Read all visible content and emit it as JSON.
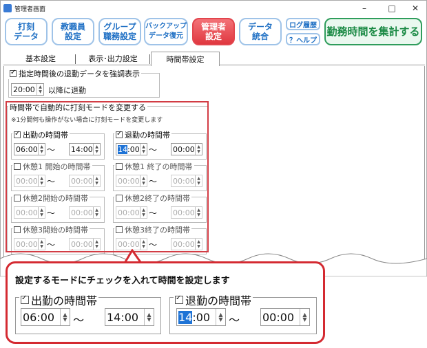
{
  "window": {
    "title": "管理者画面",
    "min": "–",
    "max": "□",
    "close": "✕"
  },
  "ribbon": {
    "buttons": [
      "打刻\nデータ",
      "教職員\n設定",
      "グループ\n職務設定",
      "バックアップ\nデータ復元",
      "管理者\n設定",
      "データ\n統合"
    ],
    "log": "ログ履歴",
    "help": "？ヘルプ",
    "total": "勤務時間を集計する"
  },
  "tabs": [
    "基本設定",
    "表示･出力設定",
    "時間帯設定"
  ],
  "emphasis": {
    "label": "指定時間後の退勤データを強調表示",
    "time": "20:00",
    "suffix": "以降に退勤"
  },
  "mode": {
    "label": "時間帯で自動的に打刻モードを変更する",
    "note": "※1分間何も操作がない場合に打刻モードを変更します",
    "groups": [
      {
        "label": "出勤の時間帯",
        "from": "06:00",
        "to": "14:00",
        "checked": true
      },
      {
        "label": "退勤の時間帯",
        "from": "14:00",
        "to": "00:00",
        "checked": true
      },
      {
        "label": "休憩1 開始の時間帯",
        "from": "00:00",
        "to": "00:00",
        "checked": false
      },
      {
        "label": "休憩1 終了の時間帯",
        "from": "00:00",
        "to": "00:00",
        "checked": false
      },
      {
        "label": "休憩2開始の時間帯",
        "from": "00:00",
        "to": "00:00",
        "checked": false
      },
      {
        "label": "休憩2終了の時間帯",
        "from": "00:00",
        "to": "00:00",
        "checked": false
      },
      {
        "label": "休憩3開始の時間帯",
        "from": "00:00",
        "to": "00:00",
        "checked": false
      },
      {
        "label": "休憩3終了の時間帯",
        "from": "00:00",
        "to": "00:00",
        "checked": false
      }
    ]
  },
  "tilde": "〜",
  "callout": {
    "title": "設定するモードにチェックを入れて時間を設定します",
    "g1": {
      "label": "出勤の時間帯",
      "from": "06:00",
      "to": "14:00"
    },
    "g2": {
      "label": "退勤の時間帯",
      "from_sel": "14",
      "from_rest": ":00",
      "to": "00:00"
    }
  }
}
